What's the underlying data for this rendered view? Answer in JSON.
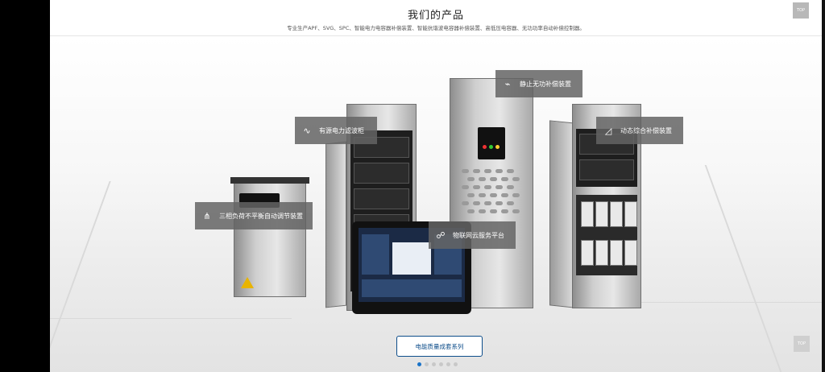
{
  "header": {
    "title": "我们的产品",
    "subtitle": "专业生产APF、SVG、SPC、智能电力电容器补偿装置、智能抗谐波电容器补偿装置、高低压电容器、无功功率自动补偿控制器。"
  },
  "top_buttons": [
    {
      "label": "TOP"
    },
    {
      "label": "TOP"
    }
  ],
  "products": [
    {
      "label": "有源电力滤波柜",
      "icon": "∿"
    },
    {
      "label": "静止无功补偿装置",
      "icon": "⌁"
    },
    {
      "label": "动态综合补偿装置",
      "icon": "◿"
    },
    {
      "label": "三相负荷不平衡自动调节装置",
      "icon": "⋔"
    },
    {
      "label": "物联网云服务平台",
      "icon": "☍"
    }
  ],
  "cta": {
    "label": "电能质量成套系列"
  },
  "carousel": {
    "count": 6,
    "active_index": 0
  }
}
